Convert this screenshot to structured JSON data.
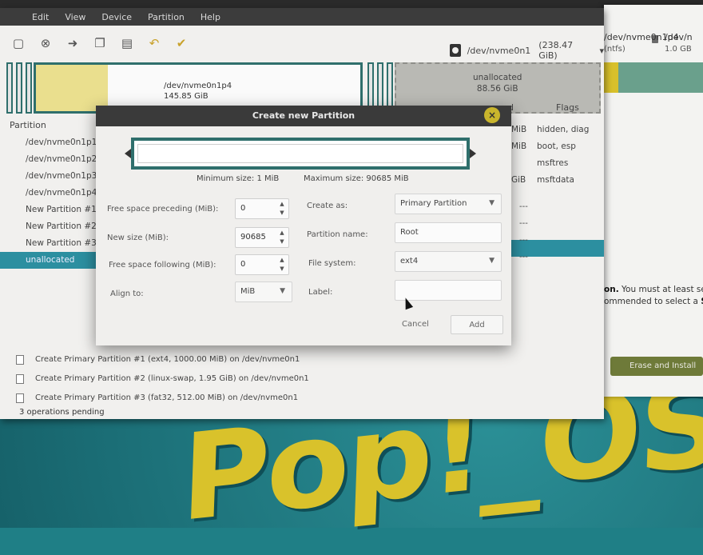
{
  "menu": [
    "",
    "Edit",
    "View",
    "Device",
    "Partition",
    "Help"
  ],
  "toolbar": {
    "icons": [
      "new-icon",
      "cancel-icon",
      "apply-arrow-icon",
      "copy-icon",
      "paste-icon",
      "undo-icon",
      "apply-check-icon"
    ]
  },
  "device_selector": {
    "label": "/dev/nvme0n1",
    "size": "(238.47 GiB)"
  },
  "disk_map": {
    "main_name": "/dev/nvme0n1p4",
    "main_size": "145.85 GiB",
    "unalloc_name": "unallocated",
    "unalloc_size": "88.56 GiB"
  },
  "partition_list": {
    "header": "Partition",
    "items": [
      "/dev/nvme0n1p1",
      "/dev/nvme0n1p2",
      "/dev/nvme0n1p3",
      "/dev/nvme0n1p4",
      "New Partition #1",
      "New Partition #2",
      "New Partition #3",
      "unallocated"
    ],
    "used_col": [
      "MiB",
      "MiB",
      "",
      "GiB"
    ],
    "flags_header": "Flags",
    "used_header": "d",
    "flags": [
      "hidden, diag",
      "boot, esp",
      "msftres",
      "msftdata"
    ],
    "dashes": [
      "---",
      "---",
      "---",
      "---"
    ]
  },
  "operations": [
    "Create Primary Partition #1 (ext4, 1000.00 MiB) on /dev/nvme0n1",
    "Create Primary Partition #2 (linux-swap, 1.95 GiB) on /dev/nvme0n1",
    "Create Primary Partition #3 (fat32, 512.00 MiB) on /dev/nvme0n1"
  ],
  "status": "3 operations pending",
  "dialog": {
    "title": "Create new Partition",
    "min_size": "Minimum size: 1 MiB",
    "max_size": "Maximum size: 90685 MiB",
    "free_preceding_label": "Free space preceding (MiB):",
    "free_preceding_value": "0",
    "new_size_label": "New size (MiB):",
    "new_size_value": "90685",
    "free_following_label": "Free space following (MiB):",
    "free_following_value": "0",
    "align_label": "Align to:",
    "align_value": "MiB",
    "create_as_label": "Create as:",
    "create_as_value": "Primary Partition",
    "name_label": "Partition name:",
    "name_value": "Root",
    "fs_label": "File system:",
    "fs_value": "ext4",
    "label_label": "Label:",
    "label_value": "",
    "cancel": "Cancel",
    "add": "Add",
    "close_glyph": "×"
  },
  "installer": {
    "dev_name": "/dev/nvme0n1p4",
    "dev_fs": "(ntfs)",
    "dev2_name": "/dev/n",
    "dev2_size": "1.0 GB",
    "text_line1_bold": "on.",
    "text_line1": " You must at least se",
    "text_line2": "ommended to select a ",
    "text_line2_bold": "S",
    "button": "Erase and Install"
  },
  "background_logo": "Pop!_OS",
  "colors": {
    "accent": "#2c8fa0",
    "partition_border": "#2f6f6c",
    "pop_yellow": "#d9c22b",
    "background_teal": "#1f7f86"
  }
}
